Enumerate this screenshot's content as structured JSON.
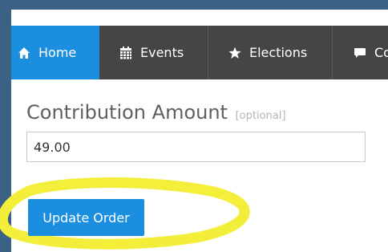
{
  "nav": {
    "items": [
      {
        "label": "Home",
        "icon": "home-icon",
        "active": true
      },
      {
        "label": "Events",
        "icon": "calendar-icon",
        "active": false
      },
      {
        "label": "Elections",
        "icon": "star-icon",
        "active": false
      },
      {
        "label": "Co",
        "icon": "comment-icon",
        "active": false
      }
    ]
  },
  "contribution": {
    "label": "Contribution Amount",
    "hint": "[optional]",
    "value": "49.00"
  },
  "actions": {
    "update_label": "Update Order"
  },
  "colors": {
    "background": "#3b6185",
    "nav_background": "#454545",
    "accent": "#1b8ee0",
    "highlight": "#f3ee3a"
  }
}
